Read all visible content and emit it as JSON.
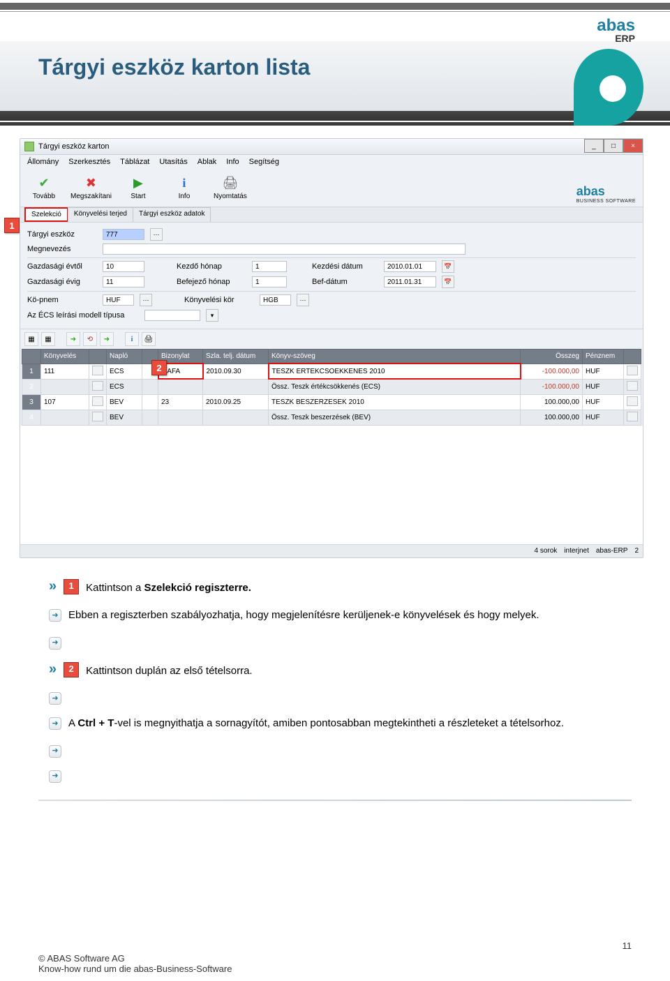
{
  "banner": {
    "title": "Tárgyi eszköz karton lista",
    "logo_top": "abas",
    "logo_top_sub": "ERP"
  },
  "window": {
    "title": "Tárgyi eszköz karton",
    "menu": [
      "Állomány",
      "Szerkesztés",
      "Táblázat",
      "Utasítás",
      "Ablak",
      "Info",
      "Segítség"
    ],
    "toolbar": [
      {
        "label": "Tovább",
        "icon": "check"
      },
      {
        "label": "Megszakítani",
        "icon": "x"
      },
      {
        "label": "Start",
        "icon": "play"
      },
      {
        "label": "Info",
        "icon": "info"
      },
      {
        "label": "Nyomtatás",
        "icon": "print"
      }
    ],
    "toolbar_logo": "abas",
    "toolbar_logo_sub": "BUSINESS SOFTWARE",
    "tabs": [
      {
        "label": "Szelekció",
        "active": true,
        "red": true
      },
      {
        "label": "Könyvelési terjed",
        "active": false
      },
      {
        "label": "Tárgyi eszköz adatok",
        "active": false
      }
    ],
    "form": {
      "targyieszkoz_label": "Tárgyi eszköz",
      "targyieszkoz_value": "777",
      "megnevezes_label": "Megnevezés",
      "megnevezes_value": "",
      "gazdevt_label": "Gazdasági évtől",
      "gazdevt_value": "10",
      "kezdoho_label": "Kezdő hónap",
      "kezdoho_value": "1",
      "kezddat_label": "Kezdési dátum",
      "kezddat_value": "2010.01.01",
      "gazdevig_label": "Gazdasági évig",
      "gazdevig_value": "11",
      "befho_label": "Befejező hónap",
      "befho_value": "1",
      "befdat_label": "Bef-dátum",
      "befdat_value": "2011.01.31",
      "kopnem_label": "Kö-pnem",
      "kopnem_value": "HUF",
      "konyvkor_label": "Könyvelési kör",
      "konyvkor_value": "HGB",
      "azecs_label": "Az ÉCS leírási modell típusa",
      "azecs_value": ""
    },
    "grid": {
      "headers": [
        "",
        "Könyvelés",
        "",
        "Napló",
        "",
        "Bizonylat",
        "Szla. telj. dátum",
        "Könyv-szöveg",
        "Összeg",
        "Pénznem",
        ""
      ],
      "rows": [
        {
          "n": "1",
          "konyv": "111",
          "naplo": "ECS",
          "biz": "ÖAFA",
          "dat": "2010.09.30",
          "szoveg": "TESZK ERTEKCSOEKKENES 2010",
          "osszeg": "-100.000,00",
          "neg": true,
          "penz": "HUF",
          "shade": false,
          "red": true
        },
        {
          "n": "2",
          "konyv": "",
          "naplo": "ECS",
          "biz": "",
          "dat": "",
          "szoveg": "Össz. Teszk értékcsökkenés (ECS)",
          "osszeg": "-100.000,00",
          "neg": true,
          "penz": "HUF",
          "shade": true
        },
        {
          "n": "3",
          "konyv": "107",
          "naplo": "BEV",
          "biz": "23",
          "dat": "2010.09.25",
          "szoveg": "TESZK BESZERZESEK 2010",
          "osszeg": "100.000,00",
          "neg": false,
          "penz": "HUF",
          "shade": false
        },
        {
          "n": "4",
          "konyv": "",
          "naplo": "BEV",
          "biz": "",
          "dat": "",
          "szoveg": "Össz. Teszk beszerzések (BEV)",
          "osszeg": "100.000,00",
          "neg": false,
          "penz": "HUF",
          "shade": true
        }
      ]
    },
    "status": [
      "4 sorok",
      "interjnet",
      "abas-ERP",
      "2"
    ]
  },
  "callouts": {
    "c1": "1",
    "c2": "2"
  },
  "instructions": {
    "i1_pre": "Kattintson a ",
    "i1_bold": "Szelekció regiszterre.",
    "i2": "Ebben a regiszterben szabályozhatja, hogy megjelenítésre kerüljenek-e könyvelések és hogy melyek.",
    "i3": "Kattintson duplán az első tételsorra.",
    "i4_pre": "A ",
    "i4_bold": "Ctrl + T",
    "i4_post": "-vel is megnyithatja a sornagyítót, amiben pontosabban megtekintheti a részleteket a tételsorhoz."
  },
  "footer": {
    "page": "11",
    "copy": "© ABAS Software AG",
    "tag": "Know-how rund um die abas-Business-Software"
  }
}
